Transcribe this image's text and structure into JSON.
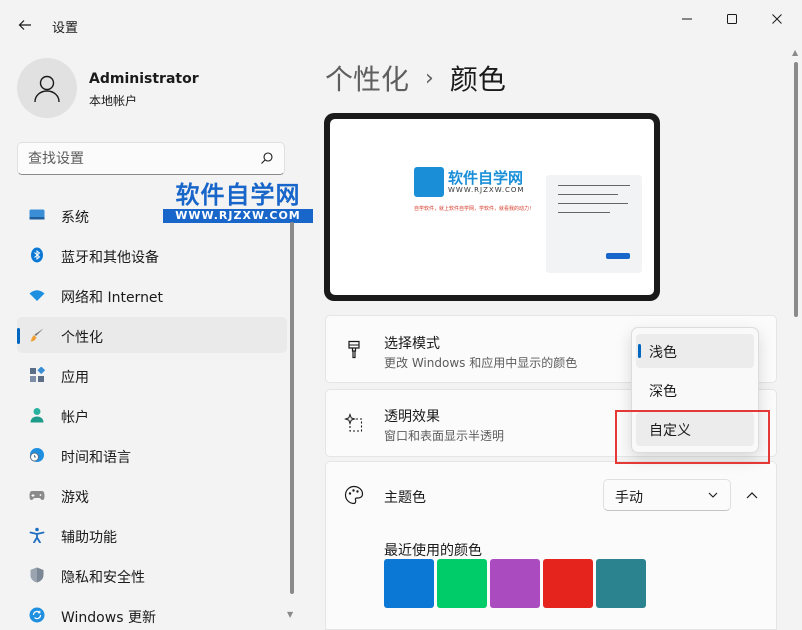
{
  "window": {
    "title": "设置"
  },
  "user": {
    "name": "Administrator",
    "account_type": "本地帐户"
  },
  "search": {
    "placeholder": "查找设置"
  },
  "watermark": {
    "title": "软件自学网",
    "url": "WWW.RJZXW.COM"
  },
  "sidebar": {
    "items": [
      {
        "label": "系统",
        "icon": "system-icon"
      },
      {
        "label": "蓝牙和其他设备",
        "icon": "bluetooth-icon"
      },
      {
        "label": "网络和 Internet",
        "icon": "wifi-icon"
      },
      {
        "label": "个性化",
        "icon": "brush-icon",
        "active": true
      },
      {
        "label": "应用",
        "icon": "apps-icon"
      },
      {
        "label": "帐户",
        "icon": "account-icon"
      },
      {
        "label": "时间和语言",
        "icon": "clock-globe-icon"
      },
      {
        "label": "游戏",
        "icon": "gamepad-icon"
      },
      {
        "label": "辅助功能",
        "icon": "accessibility-icon"
      },
      {
        "label": "隐私和安全性",
        "icon": "shield-icon"
      },
      {
        "label": "Windows 更新",
        "icon": "update-icon"
      }
    ]
  },
  "breadcrumb": {
    "parent": "个性化",
    "separator": "›",
    "current": "颜色"
  },
  "preview": {
    "logo_title": "软件自学网",
    "logo_url": "WWW.RJZXW.COM",
    "logo_slogan": "自学软件，就上软件自学网，学软件，就看我的动力！"
  },
  "mode_card": {
    "title": "选择模式",
    "description": "更改 Windows 和应用中显示的颜色",
    "icon": "paintbrush-icon"
  },
  "transparency_card": {
    "title": "透明效果",
    "description": "窗口和表面显示半透明",
    "icon": "sparkle-icon"
  },
  "accent_card": {
    "title": "主题色",
    "icon": "palette-icon",
    "dropdown_value": "手动"
  },
  "recent_colors": {
    "title": "最近使用的颜色",
    "colors": [
      "#0b78d6",
      "#00cc6a",
      "#ab4bc0",
      "#e5251d",
      "#2a838f"
    ]
  },
  "mode_menu": {
    "options": [
      "浅色",
      "深色",
      "自定义"
    ],
    "selected": "浅色",
    "hovered": "自定义"
  },
  "colors": {
    "accent": "#0067c0",
    "highlight": "#e53935"
  }
}
